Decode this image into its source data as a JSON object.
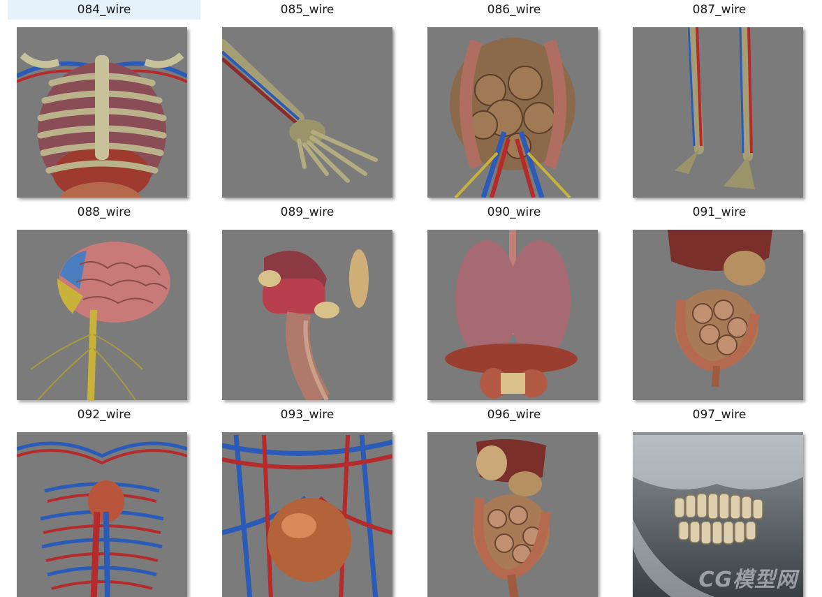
{
  "window": {
    "type": "file-explorer-thumbnails"
  },
  "items": [
    {
      "label": "084_wire",
      "image": "thorax-ribcage-organs",
      "selected": true
    },
    {
      "label": "085_wire",
      "image": "arm-hand-skeleton"
    },
    {
      "label": "086_wire",
      "image": "abdomen-intestines-vessels"
    },
    {
      "label": "087_wire",
      "image": "legs-feet-skeleton"
    },
    {
      "label": "088_wire",
      "image": "brain-spinal-cord-nerves"
    },
    {
      "label": "089_wire",
      "image": "tongue-larynx-salivary"
    },
    {
      "label": "090_wire",
      "image": "lungs-heart-diaphragm"
    },
    {
      "label": "091_wire",
      "image": "liver-intestines"
    },
    {
      "label": "092_wire",
      "image": "ribcage-vascular-system"
    },
    {
      "label": "093_wire",
      "image": "heart-vessels-closeup"
    },
    {
      "label": "096_wire",
      "image": "digestive-system"
    },
    {
      "label": "097_wire",
      "image": "skull-jaw-teeth",
      "watermark": "CG模型网"
    }
  ],
  "colors": {
    "thumb_bg": "#7b7b7b",
    "selection_bg": "#e5f1fb",
    "vein_blue": "#2a5bb8",
    "artery_red": "#b52a2a"
  }
}
